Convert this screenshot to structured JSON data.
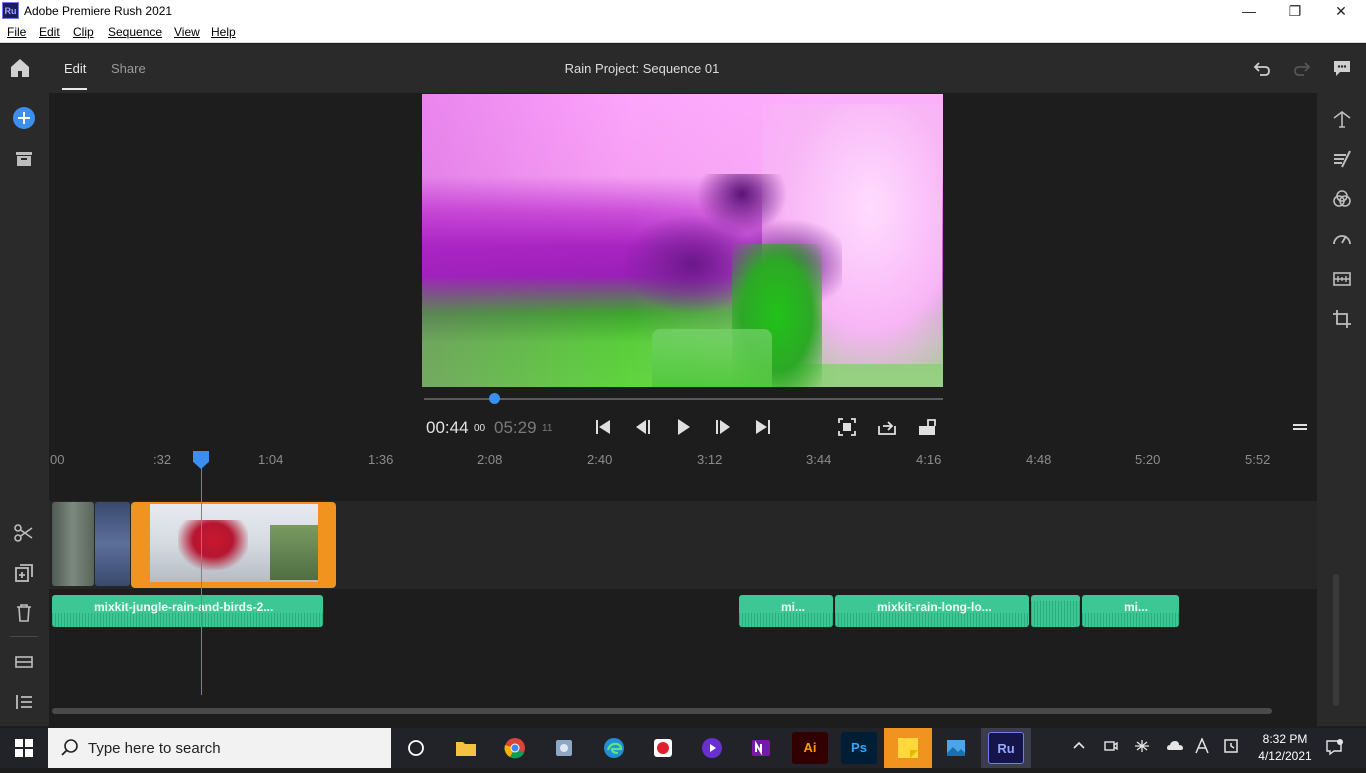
{
  "window": {
    "app_logo": "Ru",
    "title": "Adobe Premiere Rush 2021",
    "minimize": "—",
    "restore": "❐",
    "close": "✕"
  },
  "menu": [
    "File",
    "Edit",
    "Clip",
    "Sequence",
    "View",
    "Help"
  ],
  "header": {
    "home_icon": "home-icon",
    "tabs": [
      "Edit",
      "Share"
    ],
    "sequence_title": "Rain Project: Sequence 01"
  },
  "player": {
    "current_time": "00:44",
    "current_frames": "00",
    "duration": "05:29",
    "duration_frames": "11",
    "playhead_fraction": 0.134
  },
  "ruler": {
    "ticks": [
      "00",
      ":32",
      "1:04",
      "1:36",
      "2:08",
      "2:40",
      "3:12",
      "3:44",
      "4:16",
      "4:48",
      "5:20",
      "5:52"
    ]
  },
  "timeline": {
    "audio_clips": [
      "mixkit-jungle-rain-and-birds-2...",
      "mi...",
      "mixkit-rain-long-lo...",
      "",
      "mi..."
    ]
  },
  "taskbar": {
    "search_placeholder": "Type here to search",
    "apps": [
      "Ai",
      "Ps",
      "Ru"
    ],
    "time": "8:32 PM",
    "date": "4/12/2021"
  },
  "colors": {
    "accent": "#3b8ff0",
    "clip_selected": "#f0941f",
    "audio": "#3cc795"
  }
}
